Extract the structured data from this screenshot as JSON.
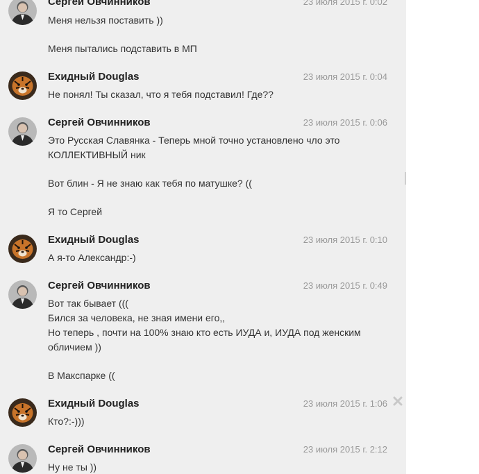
{
  "messages": [
    {
      "author": "Сергей Овчинников",
      "time": "23 июля 2015 г. 0:02",
      "lines": [
        "Меня нельзя поставить ))",
        "",
        "Меня пытались подставить в МП"
      ],
      "avatar": "man-photo"
    },
    {
      "author": "Ехидный Douglas",
      "time": "23 июля 2015 г. 0:04",
      "lines": [
        "Не понял! Ты сказал, что я тебя подставил! Где??"
      ],
      "avatar": "tiger-photo"
    },
    {
      "author": "Сергей Овчинников",
      "time": "23 июля 2015 г. 0:06",
      "lines": [
        "Это Русская Славянка - Теперь мной точно установлено чло это",
        "КОЛЛЕКТИВНЫЙ ник",
        "",
        "Вот блин - Я не знаю как тебя  по матушке? ((",
        "",
        "Я то Сергей"
      ],
      "avatar": "man-photo"
    },
    {
      "author": "Ехидный Douglas",
      "time": "23 июля 2015 г. 0:10",
      "lines": [
        "А я-то Александр:-)"
      ],
      "avatar": "tiger-photo"
    },
    {
      "author": "Сергей Овчинников",
      "time": "23 июля 2015 г. 0:49",
      "lines": [
        "Вот так бывает (((",
        "Бился за человека, не зная имени его,,",
        "Но теперь , почти на 100% знаю кто есть ИУДА и, ИУДА под женским",
        "обличием ))",
        "",
        "В Макспарке (("
      ],
      "avatar": "man-photo"
    },
    {
      "author": "Ехидный Douglas",
      "time": "23 июля 2015 г. 1:06",
      "lines": [
        "Кто?:-)))"
      ],
      "avatar": "tiger-photo"
    },
    {
      "author": "Сергей Овчинников",
      "time": "23 июля 2015 г. 2:12",
      "lines": [
        "Ну не ты ))"
      ],
      "avatar": "man-photo"
    }
  ],
  "icons": {
    "close": "close-icon"
  },
  "colors": {
    "background": "#efefef",
    "author": "#222222",
    "time": "#999999",
    "text": "#333333"
  }
}
